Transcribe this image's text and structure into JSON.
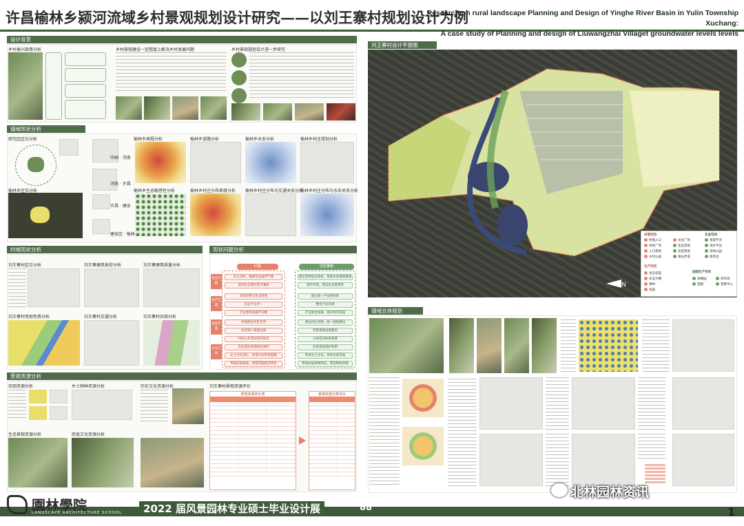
{
  "header": {
    "title_cn": "许昌榆林乡颍河流域乡村景观规划设计研究——以刘王寨村规划设计为例",
    "title_en_line1": "Research on rural landscape Planning and Design of Yinghe River Basin in Yulin Township Xuchang:",
    "title_en_line2": "A case study of Planning and  design of Liuwangzhai Villaget groundwater levels levels"
  },
  "sections": {
    "background": "设计背景",
    "area_status": "镇域现状分析",
    "village_status": "村域现状分析",
    "problems": "现状问题分析",
    "resources": "景观资源分析",
    "master_plan": "刘王寨村设计平面图",
    "town_plan": "镇域总体规划"
  },
  "background": {
    "sub1": "乡村振兴政策分析",
    "sub2": "乡村景观建设一定程度上解决乡村发展问题",
    "sub3": "乡村景观规划设计进一步研究"
  },
  "area_status": {
    "sub_location": "研究区区位分析",
    "sub_terrain": "榆林乡高程分析",
    "sub_road": "榆林乡道路分析",
    "sub_water": "榆林乡水系分析",
    "sub_village": "榆林乡村庄规划分析",
    "sub_slope": "榆林乡区位分析",
    "sub_ecology": "榆林乡生态敏感性分析",
    "sub_density": "榆林乡村庄分布密度分析",
    "sub_road_rel": "榆林乡村庄分布与交通关系分析",
    "sub_water_rel": "榆林乡村庄分布与水系关系分析",
    "place1": "中国 · 河南",
    "place2": "河南 · 许昌",
    "place3": "许昌 · 建安",
    "place4": "建安区 · 榆林乡"
  },
  "village_status": {
    "sub1": "刘王寨村区位分析",
    "sub2": "刘王寨建筑类型分析",
    "sub3": "刘王寨建筑质量分析",
    "sub4": "刘王寨村用地性质分析",
    "sub5": "刘王寨村交通分析",
    "sub6": "刘王寨村农田分析"
  },
  "problems": {
    "col_problem": "问题",
    "col_strategy": "回应策略",
    "categories": [
      "生态方面",
      "生产方面",
      "居住方面",
      "文化方面"
    ],
    "problem_items": [
      "水土流失、植被生态破坏严重",
      "湿地生态保护意识薄弱",
      "资源浪费与生态隐患",
      "农业产业单一",
      "产业结构发展不均衡",
      "村落建设杂乱无序",
      "村庄缺少基础设施",
      "村民公共活动空间缺乏",
      "历史遗迹资源缺乏保护",
      "乡土文化消亡，民俗文化传承困难",
      "传统民居衰败，建筑风貌缺乏特色"
    ],
    "strategy_items": [
      "建设湿地生态系统，恢复水生植物群落",
      "提升环境，建设生态景观带",
      "建立统一产业链体系",
      "整合产业资源",
      "产业融合发展，提升经济效益",
      "建设村庄风貌，统一规划建设",
      "完善基础设施建设",
      "公共空间体系构建",
      "历史遗迹保护利用",
      "传承乡土文化，举办民俗活动",
      "传统民居修缮改造，塑造特色风貌"
    ]
  },
  "resources": {
    "sub1": "农田资源分析",
    "sub2": "乡土物种资源分析",
    "sub3": "历史文化资源分析",
    "sub4": "刘王寨村景观资源评价",
    "sub5": "民俗文化资源分析",
    "sub6": "生态景观资源分析",
    "table_title_left": "景观资源评价表",
    "table_title_right": "景观资源分类评价"
  },
  "legend": {
    "title1": "村落空间",
    "title2": "生态空间",
    "title3": "生产空间",
    "title4": "田园生产空间",
    "items": [
      "村落入口",
      "村民广场",
      "入口景观",
      "乡村公园",
      "文化广场",
      "生态湿地",
      "农田景观",
      "观光步道",
      "景观节点",
      "滨水平台",
      "湿地公园",
      "观鸟台",
      "生态农田",
      "农业大棚",
      "果林",
      "花田",
      "采摘园",
      "苗圃",
      "停车场",
      "游客中心"
    ]
  },
  "colors": {
    "accent": "#4f6b4a",
    "problem": "#e6816b",
    "strategy": "#6f9c6c"
  },
  "footer": {
    "school_cn": "園林學院",
    "school_en": "LANDSCAPE ARCHITECTURE SCHOOL",
    "expo": "2022 届风景园林专业硕士毕业设计展",
    "expo_num": "88",
    "watermark": "北林园林资讯",
    "page_number": "1"
  },
  "icons": [
    "wechat-icon",
    "north-arrow-icon",
    "school-logo-icon",
    "arrow-right-icon"
  ]
}
